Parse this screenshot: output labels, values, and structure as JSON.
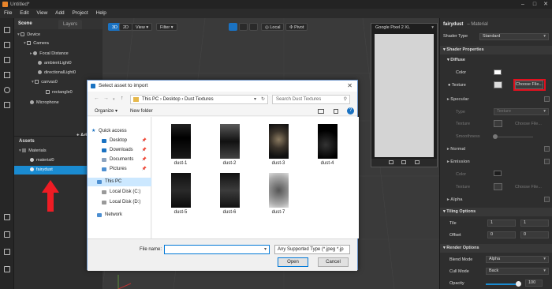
{
  "app": {
    "title": "Untitled*"
  },
  "menu": [
    "File",
    "Edit",
    "View",
    "Add",
    "Project",
    "Help"
  ],
  "scene": {
    "tab": "Scene",
    "layers_tab": "Layers",
    "nodes": [
      "Device",
      "Camera",
      "Focal Distance",
      "ambientLight0",
      "directionalLight0",
      "canvas0",
      "rectangle0",
      "Microphone"
    ],
    "add_object": "+ Add O"
  },
  "assets": {
    "header": "Assets",
    "items": [
      "Materials",
      "material0",
      "fairydust"
    ]
  },
  "viewport": {
    "mode_3d": "3D",
    "mode_2d": "2D",
    "view": "View",
    "filter": "Filter",
    "local": "Local",
    "pivot": "Pivot",
    "device": "Google Pixel 2 XL"
  },
  "inspector": {
    "name": "fairydust",
    "type_label": "– Material",
    "shader_type_label": "Shader Type",
    "shader_type": "Standard",
    "sections": {
      "shader_props": "Shader Properties",
      "diffuse": "Diffuse",
      "specular": "Specular",
      "normal": "Normal",
      "emission": "Emission",
      "alpha": "Alpha",
      "tiling": "Tiling Options",
      "render": "Render Options"
    },
    "color": "Color",
    "texture": "Texture",
    "choose_file": "Choose File...",
    "type": "Type",
    "type_val": "Texture",
    "smoothness": "Smoothness",
    "tile": "Tile",
    "tile_x": "1",
    "tile_y": "1",
    "offset": "Offset",
    "offset_x": "0",
    "offset_y": "0",
    "blend_mode": "Blend Mode",
    "blend_val": "Alpha",
    "cull_mode": "Cull Mode",
    "cull_val": "Back",
    "opacity": "Opacity",
    "opacity_val": "100"
  },
  "dialog": {
    "title": "Select asset to import",
    "breadcrumb": "This PC  ›  Desktop  ›  Dust Textures",
    "search_placeholder": "Search Dust Textures",
    "organize": "Organize ▾",
    "new_folder": "New folder",
    "nav": [
      "Quick access",
      "Desktop",
      "Downloads",
      "Documents",
      "Pictures",
      "This PC",
      "Local Disk (C:)",
      "Local Disk (D:)",
      "Network"
    ],
    "files": [
      "dust-1",
      "dust-2",
      "dust-3",
      "dust-4",
      "dust-5",
      "dust-6",
      "dust-7"
    ],
    "filename_label": "File name:",
    "filter": "Any Supported Type (*.jpeg *.jp",
    "open": "Open",
    "cancel": "Cancel"
  }
}
